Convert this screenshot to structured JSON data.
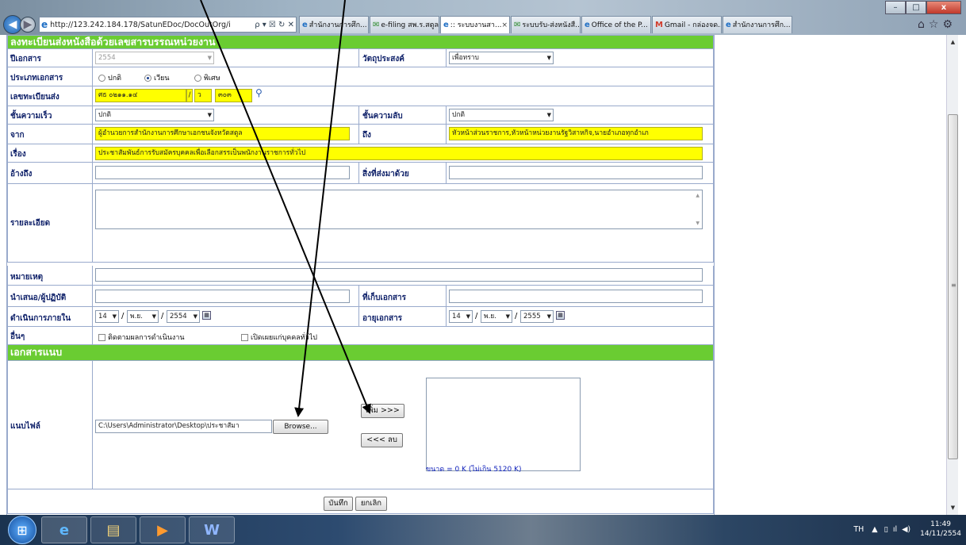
{
  "browser": {
    "url": "http://123.242.184.178/SatunEDoc/DocOutOrg/i",
    "url_tools": "ρ ▾ ☒ ↻ ✕",
    "tabs": [
      {
        "label": "สำนักงานการศึก...",
        "icon": "ie-icon"
      },
      {
        "label": "e-filing สพ.ร.สตูล",
        "icon": "mail-icon"
      },
      {
        "label": ":: ระบบงานสา...",
        "icon": "ie-icon",
        "active": true,
        "close": "×"
      },
      {
        "label": "ระบบรับ-ส่งหนังสื...",
        "icon": "mail-icon"
      },
      {
        "label": "Office of the P...",
        "icon": "ie-icon"
      },
      {
        "label": "Gmail - กล่องจด...",
        "icon": "gmail-icon"
      },
      {
        "label": "สำนักงานการศึก...",
        "icon": "ie-icon"
      }
    ],
    "toolbar_icons": [
      "home-icon",
      "favorites-icon",
      "tools-icon"
    ],
    "window_buttons": [
      "minimize",
      "maximize",
      "close"
    ]
  },
  "form": {
    "title": "ลงทะเบียนส่งหนังสือด้วยเลขสารบรรณหน่วยงาน",
    "year": {
      "label": "ปีเอกสาร",
      "value": "2554"
    },
    "purpose": {
      "label": "วัตถุประสงค์",
      "value": "เพื่อทราบ"
    },
    "doctype": {
      "label": "ประเภทเอกสาร",
      "options": [
        "ปกติ",
        "เวียน",
        "พิเศษ"
      ],
      "selected": "เวียน"
    },
    "regno": {
      "label": "เลขทะเบียนส่ง",
      "prefix": "ศธ ๐๒๑๑.๑๔",
      "sep": "/",
      "suffix": "ว",
      "number": "๓๐๓"
    },
    "speed": {
      "label": "ชั้นความเร็ว",
      "value": "ปกติ"
    },
    "secret": {
      "label": "ชั้นความลับ",
      "value": "ปกติ"
    },
    "from": {
      "label": "จาก",
      "value": "ผู้อำนวยการสำนักงานการศึกษาเอกชนจังหวัดสตูล"
    },
    "to": {
      "label": "ถึง",
      "value": "หัวหน้าส่วนราชการ,หัวหน้าหน่วยงานรัฐวิสาหกิจ,นายอำเภอทุกอำเภ"
    },
    "subject": {
      "label": "เรื่อง",
      "value": "ประชาสัมพันธ์การรับสมัครบุคคลเพื่อเลือกสรรเป็นพนักงานราชการทั่วไป"
    },
    "ref": {
      "label": "อ้างถึง",
      "value": ""
    },
    "enclosure": {
      "label": "สิ่งที่ส่งมาด้วย",
      "value": ""
    },
    "details": {
      "label": "รายละเอียด"
    },
    "remark": {
      "label": "หมายเหตุ",
      "value": ""
    },
    "presenter": {
      "label": "นำเสนอ/ผู้ปฏิบัติ",
      "value": ""
    },
    "location": {
      "label": "ที่เก็บเอกสาร",
      "value": ""
    },
    "due": {
      "label": "ดำเนินการภายใน",
      "day": "14",
      "sep": "/",
      "month": "พ.ย.",
      "year": "2554"
    },
    "expire": {
      "label": "อายุเอกสาร",
      "day": "14",
      "sep": "/",
      "month": "พ.ย.",
      "year": "2555"
    },
    "other": {
      "label": "อื่นๆ",
      "track": "ติดตามผลการดำเนินงาน",
      "public": "เปิดเผยแก่บุคคลทั่วไป"
    },
    "attach_title": "เอกสารแนบ",
    "attach": {
      "label": "แนบไฟล์",
      "path": "C:\\Users\\Administrator\\Desktop\\ประชาสัมา",
      "browse": "Browse...",
      "add": "เพิ่ม >>>",
      "remove": "<<< ลบ",
      "size_note": "ขนาด = 0 K (ไม่เกิน 5120 K)"
    },
    "save": "บันทึก",
    "cancel": "ยกเลิก"
  },
  "taskbar": {
    "apps": [
      "start-orb",
      "ie-icon",
      "explorer-icon",
      "media-player-icon",
      "word-icon"
    ],
    "lang": "TH",
    "time": "11:49",
    "date": "14/11/2554"
  }
}
